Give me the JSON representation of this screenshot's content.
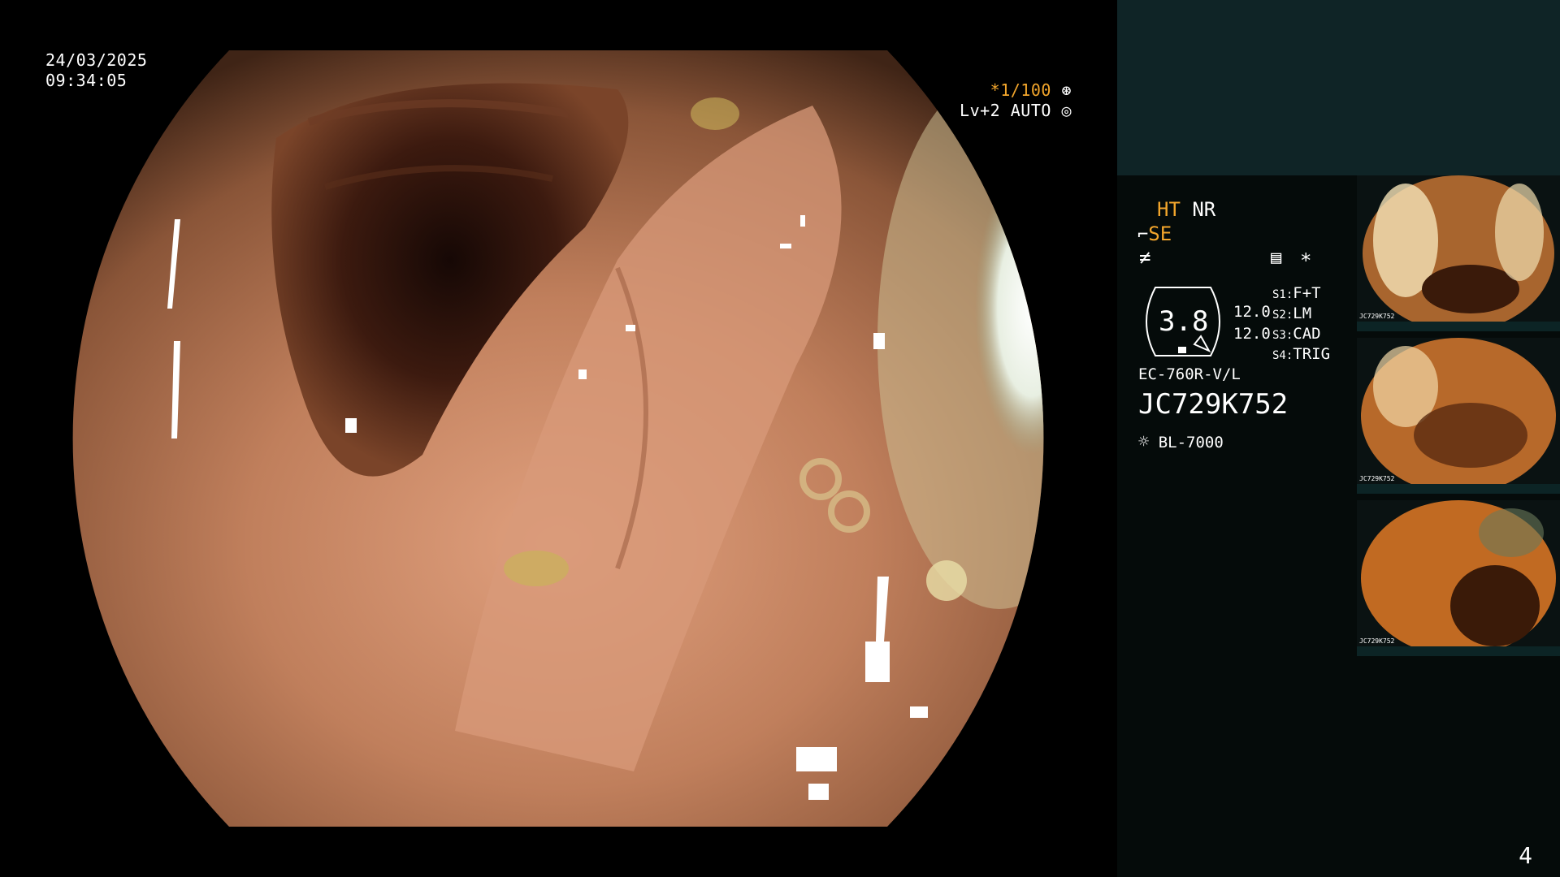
{
  "overlay": {
    "date": "24/03/2025",
    "time": "09:34:05",
    "shutter": "*1/100",
    "level": "Lv+2 AUTO"
  },
  "settings": {
    "ht": "HT",
    "nr": "NR",
    "se": "SE",
    "gauge_value": "3.8",
    "value_1": "12.0",
    "value_2": "12.0",
    "s1": "S1:",
    "s1_value": "F+T",
    "s2": "S2:",
    "s2_value": "LM",
    "s3": "S3:",
    "s3_value": "CAD",
    "s4": "S4:",
    "s4_value": "TRIG",
    "asterisk": "*",
    "scope_model": "EC-760R-V/L",
    "serial": "JC729K752",
    "light_source": "BL-7000"
  },
  "thumbnails": [
    {
      "serial": "JC729K752"
    },
    {
      "serial": "JC729K752"
    },
    {
      "serial": "JC729K752"
    }
  ],
  "page_number": "4",
  "colors": {
    "accent": "#f3a62c",
    "panel_top": "#0f2426",
    "panel": "#050b0a"
  }
}
